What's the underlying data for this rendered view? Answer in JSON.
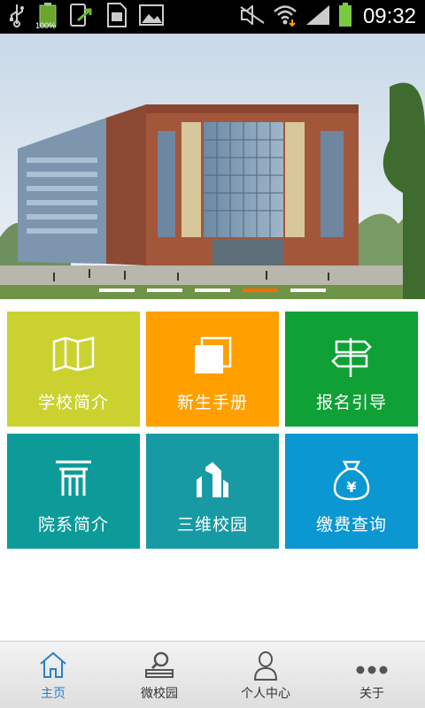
{
  "status_bar": {
    "time": "09:32",
    "battery_percent": "100%",
    "icons": [
      "usb-icon",
      "battery-small-icon",
      "app-update-icon",
      "sd-card-icon",
      "image-icon",
      "mute-icon",
      "wifi-icon",
      "signal-icon",
      "battery-icon"
    ]
  },
  "banner": {
    "image": "building-photo",
    "slide_count": 5,
    "active_slide": 4,
    "indicator_active_color": "#ff6a00"
  },
  "tiles": [
    {
      "label": "学校简介",
      "icon": "map-icon",
      "color": "#cbd230"
    },
    {
      "label": "新生手册",
      "icon": "booklet-icon",
      "color": "#ff9f00"
    },
    {
      "label": "报名引导",
      "icon": "signpost-icon",
      "color": "#0fa135"
    },
    {
      "label": "院系简介",
      "icon": "gate-icon",
      "color": "#0d9b9a"
    },
    {
      "label": "三维校园",
      "icon": "buildings-3d-icon",
      "color": "#179aa4"
    },
    {
      "label": "缴费查询",
      "icon": "money-bag-icon",
      "color": "#0a97d2"
    }
  ],
  "tab_bar": {
    "tabs": [
      {
        "label": "主页",
        "icon": "home-icon",
        "active": true
      },
      {
        "label": "微校园",
        "icon": "campus-icon",
        "active": false
      },
      {
        "label": "个人中心",
        "icon": "person-icon",
        "active": false
      },
      {
        "label": "关于",
        "icon": "more-dots-icon",
        "active": false
      }
    ],
    "active_color": "#2a7fc4"
  }
}
